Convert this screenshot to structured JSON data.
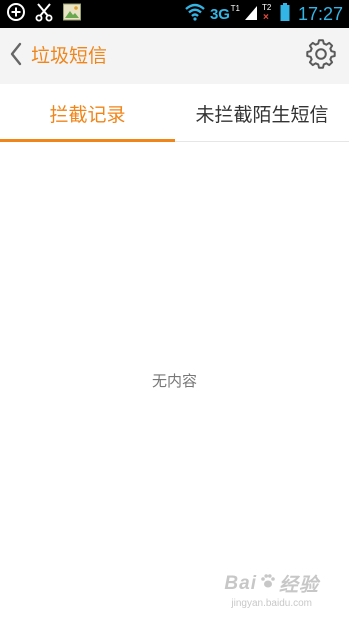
{
  "status_bar": {
    "icons_left": [
      "add-circle-icon",
      "scissors-icon",
      "picture-icon"
    ],
    "icons_right": [
      "wifi-icon",
      "signal-icon",
      "battery-icon"
    ],
    "network_label": "3G",
    "sim1_tag": "T1",
    "sim2_tag": "T2",
    "sim2_mark": "×",
    "time": "17:27",
    "accent_color": "#33b5e5"
  },
  "header": {
    "title": "垃圾短信",
    "back_icon": "chevron-left-icon",
    "settings_icon": "gear-icon",
    "title_color": "#f08519"
  },
  "tabs": [
    {
      "label": "拦截记录",
      "selected": true
    },
    {
      "label": "未拦截陌生短信",
      "selected": false
    }
  ],
  "content": {
    "empty_text": "无内容"
  },
  "watermark": {
    "brand": "Bai",
    "brand_suffix": "经验",
    "url": "jingyan.baidu.com"
  }
}
